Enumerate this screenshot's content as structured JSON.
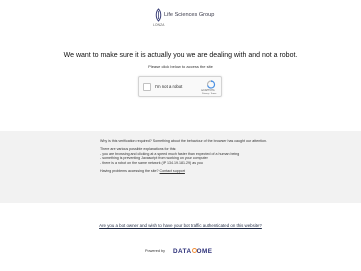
{
  "header": {
    "brand_name": "Life Sciences Group",
    "brand_sub": "LONZA"
  },
  "main": {
    "headline": "We want to make sure it is actually you we are dealing with and not a robot.",
    "instruction": "Please click below to access the site"
  },
  "captcha": {
    "label": "I'm not a robot",
    "brand": "reCAPTCHA",
    "links": "Privacy - Terms",
    "colors": {
      "blue": "#4a90e2",
      "gray": "#b7b7b7"
    }
  },
  "info": {
    "question": "Why is this verification required? Something about the behaviour of the browser has caught our attention.",
    "reasons_intro": "There are various possible explanations for this:",
    "reason_1": "- you are browsing and clicking at a speed much faster than expected of a human being",
    "reason_2": "- something is preventing Javascript from working on your computer",
    "reason_3": "- there is a robot on the same network (IP 134.19.181.29) as you",
    "problems_text": "Having problems accessing the site?",
    "contact_label": "Contact support"
  },
  "footer": {
    "bot_owner_link": "Are you a bot owner and wish to have your bot traffic authenticated on this website?",
    "powered_by": "Powered by",
    "datadome_left": "DATA",
    "datadome_right": "OME"
  }
}
